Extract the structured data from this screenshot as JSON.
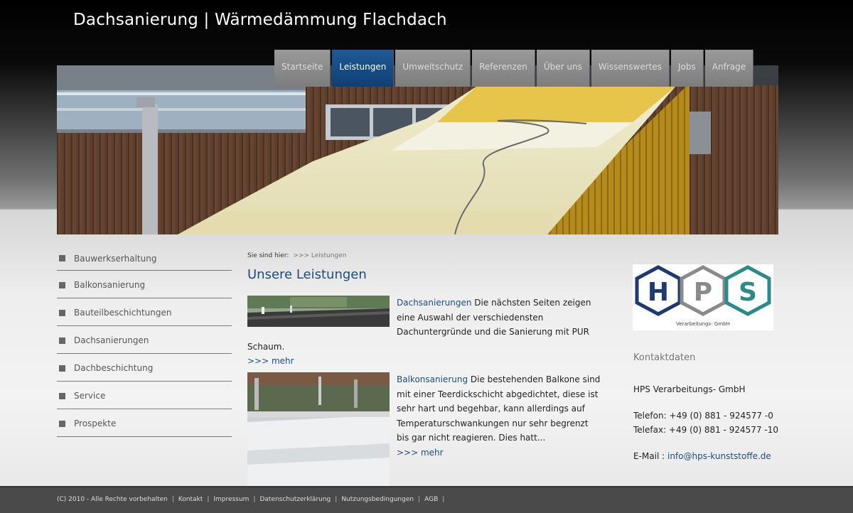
{
  "site_title": "Dachsanierung | Wärmedämmung Flachdach",
  "nav": {
    "items": [
      "Startseite",
      "Leistungen",
      "Umweltschutz",
      "Referenzen",
      "Über uns",
      "Wissenswertes",
      "Jobs",
      "Anfrage"
    ],
    "active": "Leistungen"
  },
  "sidebar": {
    "items": [
      "Bauwerkserhaltung",
      "Balkonsanierung",
      "Bauteilbeschichtungen",
      "Dachsanierungen",
      "Dachbeschichtung",
      "Service",
      "Prospekte"
    ]
  },
  "breadcrumb": {
    "label": "Sie sind hier:",
    "current": ">>> Leistungen"
  },
  "main": {
    "title": "Unsere Leistungen",
    "articles": [
      {
        "link": "Dachsanierungen",
        "text": " Die nächsten Seiten zeigen eine Auswahl der verschiedensten Dachuntergründe und die Sanierung mit PUR Schaum.",
        "more": ">>> mehr"
      },
      {
        "link": "Balkonsanierung",
        "text": " Die bestehenden Balkone sind mit einer Teerdickschicht abgedichtet, diese ist sehr hart und begehbar, kann allerdings auf Temperaturschwankungen nur sehr begrenzt bis gar nicht reagieren. Dies hatt...",
        "more": ">>> mehr"
      }
    ]
  },
  "logo": {
    "letters": [
      "H",
      "P",
      "S"
    ],
    "subtitle": "Verarbeitungs- GmbH"
  },
  "contact": {
    "title": "Kontaktdaten",
    "company": "HPS Verarbeitungs- GmbH",
    "phone": "Telefon: +49 (0) 881 - 924577 -0",
    "fax": "Telefax: +49 (0) 881 - 924577 -10",
    "email_label": "E-Mail :",
    "email": "info@hps-kunststoffe.de"
  },
  "footer": {
    "links": [
      "(C) 2010 - Alle Rechte vorbehalten",
      "Kontakt",
      "Impressum",
      "Datenschutzerklärung",
      "Nutzungsbedingungen",
      "AGB"
    ]
  }
}
